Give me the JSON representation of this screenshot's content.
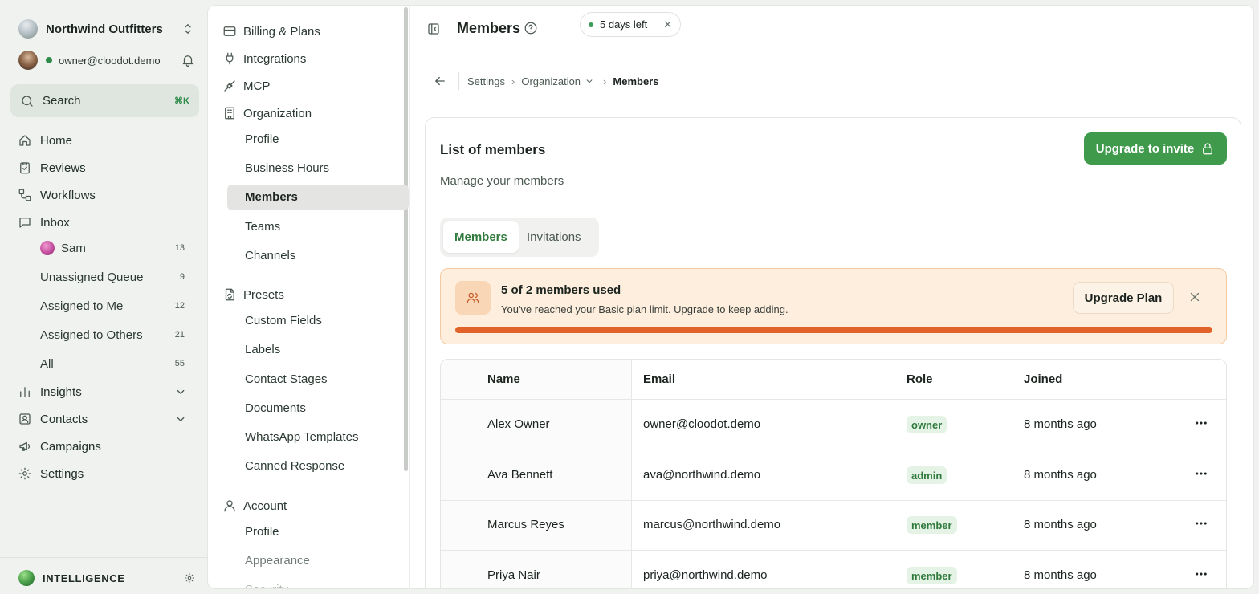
{
  "sidebar": {
    "org_name": "Northwind Outfitters",
    "user_email": "owner@cloodot.demo",
    "search_label": "Search",
    "search_shortcut": "⌘K",
    "nav": {
      "home": "Home",
      "reviews": "Reviews",
      "workflows": "Workflows",
      "inbox": "Inbox",
      "insights": "Insights",
      "contacts": "Contacts",
      "campaigns": "Campaigns",
      "settings": "Settings"
    },
    "inbox_items": [
      {
        "label": "Sam",
        "count": "13"
      },
      {
        "label": "Unassigned Queue",
        "count": "9"
      },
      {
        "label": "Assigned to Me",
        "count": "12"
      },
      {
        "label": "Assigned to Others",
        "count": "21"
      },
      {
        "label": "All",
        "count": "55"
      }
    ],
    "intelligence_label": "INTELLIGENCE"
  },
  "settings_panel": {
    "billing": "Billing & Plans",
    "integrations": "Integrations",
    "mcp": "MCP",
    "organization": "Organization",
    "org_items": [
      "Profile",
      "Business Hours",
      "Members",
      "Teams",
      "Channels"
    ],
    "presets": "Presets",
    "preset_items": [
      "Custom Fields",
      "Labels",
      "Contact Stages",
      "Documents",
      "WhatsApp Templates",
      "Canned Response"
    ],
    "account": "Account",
    "account_items": [
      "Profile",
      "Appearance",
      "Security"
    ]
  },
  "header": {
    "title": "Members",
    "trial_label": "5 days left"
  },
  "breadcrumb": {
    "settings": "Settings",
    "organization": "Organization",
    "current": "Members"
  },
  "card": {
    "title": "List of members",
    "subtitle": "Manage your members",
    "invite_button": "Upgrade to invite",
    "tabs": [
      "Members",
      "Invitations"
    ],
    "limit": {
      "title": "5 of 2 members used",
      "text": "You've reached your Basic plan limit. Upgrade to keep adding.",
      "button": "Upgrade Plan",
      "usage_fraction": 1.0
    },
    "table": {
      "columns": [
        "Name",
        "Email",
        "Role",
        "Joined"
      ],
      "rows": [
        {
          "name": "Alex Owner",
          "email": "owner@cloodot.demo",
          "role": "owner",
          "joined": "8 months ago"
        },
        {
          "name": "Ava Bennett",
          "email": "ava@northwind.demo",
          "role": "admin",
          "joined": "8 months ago"
        },
        {
          "name": "Marcus Reyes",
          "email": "marcus@northwind.demo",
          "role": "member",
          "joined": "8 months ago"
        },
        {
          "name": "Priya Nair",
          "email": "priya@northwind.demo",
          "role": "member",
          "joined": "8 months ago"
        }
      ]
    }
  },
  "colors": {
    "brand_green": "#3f9a4c",
    "warning_orange": "#e2632a",
    "banner_bg": "#fdeedd"
  }
}
